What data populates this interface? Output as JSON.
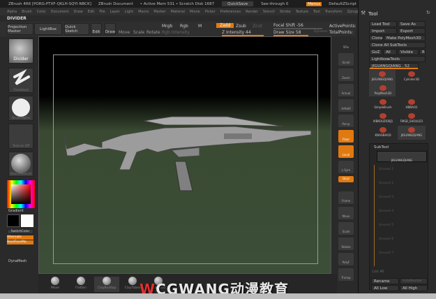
{
  "titlebar": {
    "app": "ZBrush 4R6 [PORG-PTXF-QKLH-SQYI-NBCK]",
    "doc": "ZBrush Document",
    "mem": "• Active Mem 531 • Scratch Disk 1687",
    "quicksave": "QuickSave",
    "seethrough": "See-through 0",
    "menus": "Menus",
    "script": "DefaultZScript"
  },
  "menubar": [
    "Alpha",
    "Brush",
    "Color",
    "Document",
    "Draw",
    "Edit",
    "File",
    "Layer",
    "Light",
    "Macro",
    "Marker",
    "Material",
    "Movie",
    "Picker",
    "Preferences",
    "Render",
    "Stencil",
    "Stroke",
    "Texture",
    "Tool",
    "Transform",
    "Zplugin",
    "Zscript"
  ],
  "palette_name": "DIVIDER",
  "toolbar": {
    "projection_master": "Projection Master",
    "lightbox": "LightBox",
    "quick_sketch": "Quick Sketch",
    "edit": "Edit",
    "draw": "Draw",
    "move": "Move",
    "scale": "Scale",
    "rotate": "Rotate",
    "mrgb": "Mrgb",
    "rgb": "Rgb",
    "m": "M",
    "rgb_intensity": "Rgb Intensity",
    "zadd": "Zadd",
    "zsub": "Zsub",
    "zcut": "Zcut",
    "z_intensity": "Z Intensity 44",
    "focal_shift": "Focal Shift -56",
    "draw_size": "Draw Size 58",
    "dynamic": "Dynamic",
    "active_points": "ActivePoints:",
    "total_points": "TotalPoints:"
  },
  "leftshelf": {
    "brush": "Divider",
    "stroke": "FreeHand",
    "alpha": "BrushAlpha",
    "texture": "Texture Off",
    "material": "BasicMaterial",
    "gradient": "Gradient",
    "switch_color": "SwitchColor",
    "alternate": "Alternate",
    "backface": "BackFaceMa",
    "dynamesh": "DynaMesh",
    "colors": {
      "main": "#000000",
      "secondary": "#ffffff"
    }
  },
  "rightstrip": [
    "SPix",
    "Scroll",
    "Zoom",
    "Actual",
    "AAHalf",
    "Persp",
    "Floor",
    "Local",
    "L.Sym",
    "Qxyz",
    "Frame",
    "Move",
    "Scale",
    "Rotate",
    "PolyF",
    "Transp"
  ],
  "toolpanel": {
    "title": "Tool",
    "load_tool": "Load Tool",
    "save_as": "Save As",
    "import": "Import",
    "export": "Export",
    "clone": "Clone",
    "make_polymesh": "Make PolyMesh3D",
    "clone_all": "Clone All SubTools",
    "goz": "GoZ",
    "all": "All",
    "visible": "Visible",
    "r": "R",
    "lightbox_tools": "Lightbox▸Tools",
    "current_tool": "JIGUANGQIANG . 52",
    "tools": [
      {
        "name": "JIGUANGQIANG",
        "count": ""
      },
      {
        "name": "Cylinder3D",
        "count": ""
      },
      {
        "name": "PolyMesh3D",
        "count": ""
      },
      {
        "name": "SimpleBrush",
        "count": ""
      },
      {
        "name": "HBNAO2",
        "count": "2"
      },
      {
        "name": "XIBKOUZIOBJ1",
        "count": "6"
      },
      {
        "name": "FMSD_SHOULD1",
        "count": "2"
      },
      {
        "name": "KNAOBAOD",
        "count": ""
      },
      {
        "name": "JIGUANGQIANG",
        "count": ""
      }
    ]
  },
  "subtool": {
    "title": "SubTool",
    "active": "JIGUANGQIANG",
    "empty": [
      "Unused 1",
      "Unused 2",
      "Unused 3",
      "Unused 4",
      "Unused 5",
      "Unused 6",
      "Unused 7"
    ],
    "list_all": "List All",
    "rename": "Rename",
    "autoreorder": "AutoReorder",
    "all_low": "All Low",
    "all_high": "All High"
  },
  "bottomshelf": [
    "Move",
    "Flatten",
    "ClayBuildup",
    "ClayTubes",
    "Standard"
  ],
  "watermark": "CGWANG动漫教育",
  "accent": "#e07a10"
}
